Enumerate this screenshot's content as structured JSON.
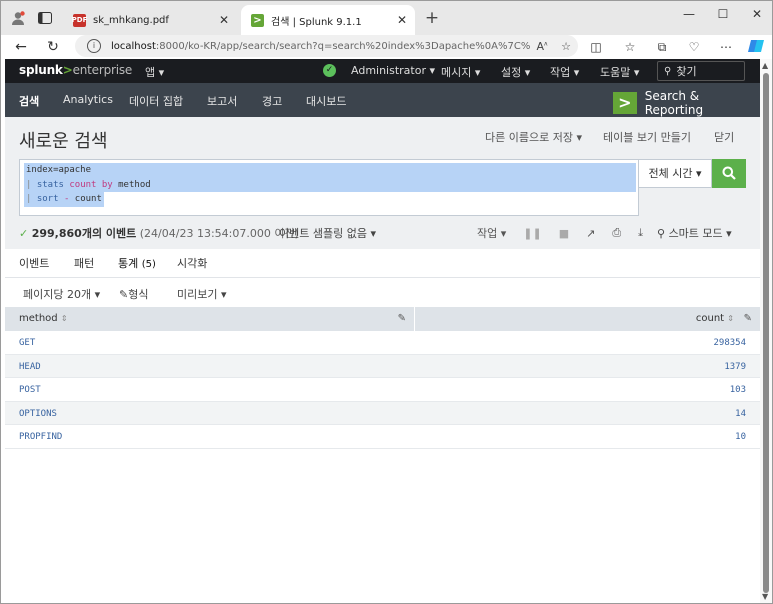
{
  "browser": {
    "tabs": [
      {
        "title": "sk_mhkang.pdf",
        "active": false,
        "icon": "pdf-icon"
      },
      {
        "title": "검색 | Splunk 9.1.1",
        "active": true,
        "icon": "splunk-icon"
      }
    ],
    "new_tab": "+",
    "window_controls": [
      "—",
      "☐",
      "✕"
    ],
    "url_host": "localhost",
    "url_rest": ":8000/ko-KR/app/search/search?q=search%20index%3Dapache%0A%7C%20st..."
  },
  "splunk": {
    "logo": {
      "part1": "splunk",
      "part2": ">",
      "part3": "enterprise"
    },
    "app_menu": "앱 ▾",
    "top_menu": [
      {
        "label": "Administrator ▾"
      },
      {
        "label": "메시지 ▾"
      },
      {
        "label": "설정 ▾"
      },
      {
        "label": "작업 ▾"
      },
      {
        "label": "도움말 ▾"
      }
    ],
    "find_placeholder": "찾기",
    "app_nav": [
      {
        "label": "검색",
        "active": true
      },
      {
        "label": "Analytics"
      },
      {
        "label": "데이터 집합"
      },
      {
        "label": "보고서"
      },
      {
        "label": "경고"
      },
      {
        "label": "대시보드"
      }
    ],
    "app_title": "Search & Reporting",
    "page_title": "새로운 검색",
    "page_actions": [
      {
        "label": "다른 이름으로 저장 ▾"
      },
      {
        "label": "테이블 보기 만들기"
      },
      {
        "label": "닫기"
      }
    ],
    "query": {
      "line1_text": "index=apache",
      "line2_pipe": "| ",
      "line2_cmd": "stats",
      "line2_fn": "count",
      "line2_by": "by",
      "line2_field": "method",
      "line3_pipe": "| ",
      "line3_cmd": "sort",
      "line3_op": "-",
      "line3_field": "count"
    },
    "time_picker": "전체 시간 ▾",
    "status": {
      "count": "299,860개의 이벤트",
      "detail": "(24/04/23 13:54:07.000 이전)"
    },
    "sampling": "이벤트 샘플링 없음 ▾",
    "job_menu": "작업 ▾",
    "smart_mode": "스마트 모드 ▾",
    "result_tabs": [
      {
        "label": "이벤트",
        "count": ""
      },
      {
        "label": "패턴",
        "count": ""
      },
      {
        "label": "통계",
        "count": "(5)",
        "active": true
      },
      {
        "label": "시각화",
        "count": ""
      }
    ],
    "options": {
      "per_page": "페이지당 20개 ▾",
      "format": "형식",
      "preview": "미리보기 ▾"
    },
    "table": {
      "columns": [
        "method",
        "count"
      ],
      "rows": [
        {
          "method": "GET",
          "count": "298354"
        },
        {
          "method": "HEAD",
          "count": "1379"
        },
        {
          "method": "POST",
          "count": "103"
        },
        {
          "method": "OPTIONS",
          "count": "14"
        },
        {
          "method": "PROPFIND",
          "count": "10"
        }
      ]
    }
  }
}
